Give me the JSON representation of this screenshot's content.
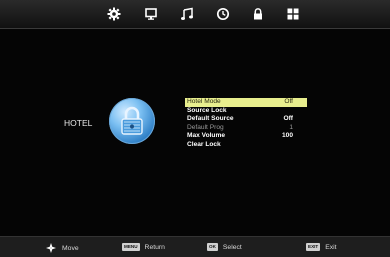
{
  "top_icons": [
    "settings-icon",
    "monitor-icon",
    "music-icon",
    "clock-icon",
    "lock-icon",
    "grid-icon"
  ],
  "section": {
    "label": "HOTEL",
    "icon": "padlock-icon"
  },
  "menu": {
    "items": [
      {
        "label": "Hotel Mode",
        "value": "Off",
        "state": "selected"
      },
      {
        "label": "Source Lock",
        "value": "",
        "state": "normal"
      },
      {
        "label": "Default Source",
        "value": "Off",
        "state": "normal"
      },
      {
        "label": "Default  Prog",
        "value": "1",
        "state": "disabled"
      },
      {
        "label": "Max  Volume",
        "value": "100",
        "state": "normal"
      },
      {
        "label": "Clear  Lock",
        "value": "",
        "state": "normal"
      }
    ]
  },
  "bottom_bar": {
    "move": {
      "label": "Move",
      "icon": "dpad-icon"
    },
    "return": {
      "key": "MENU",
      "label": "Return"
    },
    "select": {
      "key": "OK",
      "label": "Select"
    },
    "exit": {
      "key": "EXIT",
      "label": "Exit"
    }
  },
  "colors": {
    "highlight": "#e8ee8e",
    "lock_blue": "#2e7fc6",
    "background": "#050505"
  }
}
